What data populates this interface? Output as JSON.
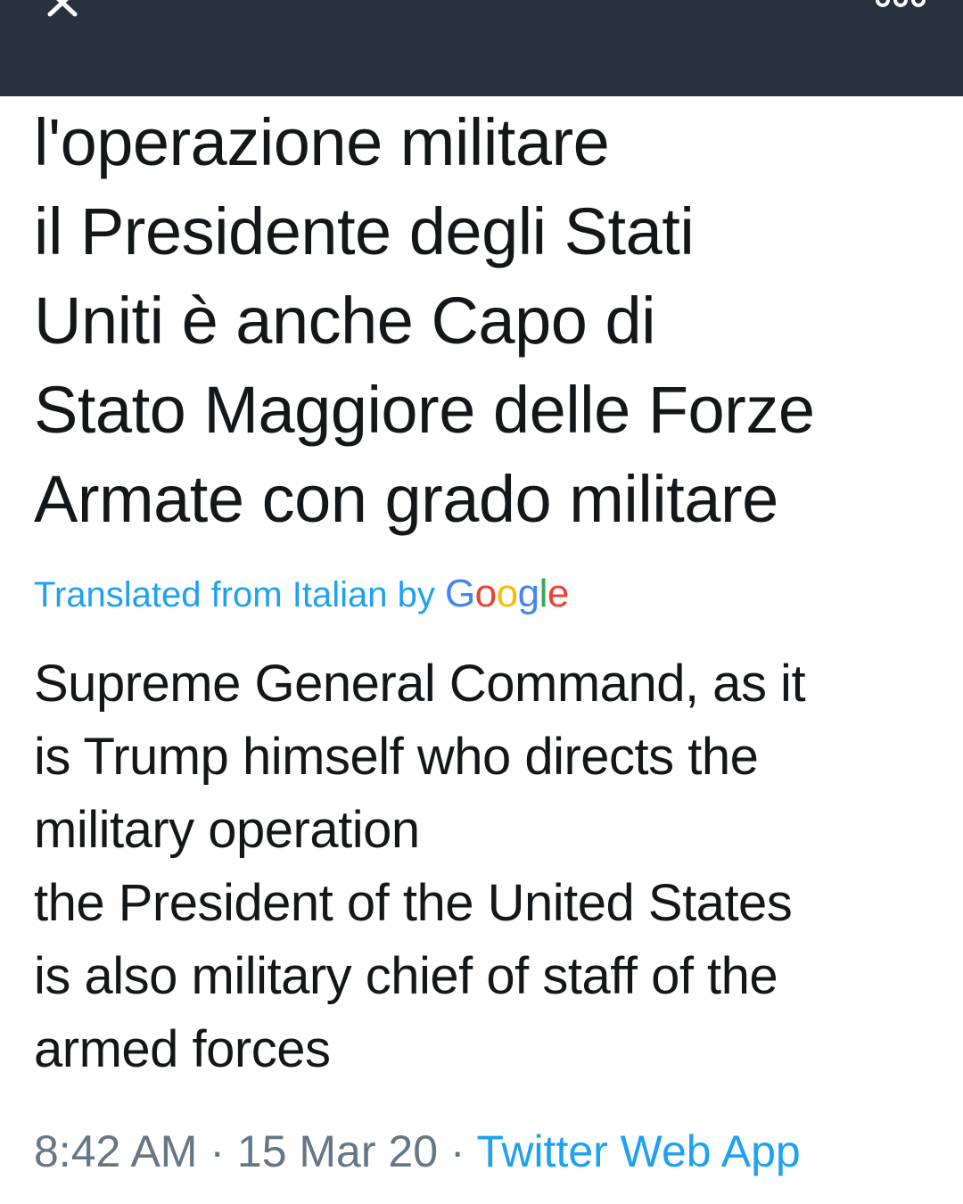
{
  "header": {
    "close_icon": "close-icon",
    "more_icon": "more-icon"
  },
  "tweet": {
    "original_text": "l'operazione militare\nil Presidente degli Stati\nUniti è anche Capo di\nStato Maggiore delle Forze\nArmate con grado militare",
    "translation_label": "Translated from Italian by ",
    "translation_provider": "Google",
    "translated_text": "Supreme General Command, as it\nis Trump himself who directs the\nmilitary operation\n the President of the United States\nis also military chief of staff of the\narmed forces",
    "time": "8:42 AM",
    "date": "15 Mar 20",
    "separator": " · ",
    "source": "Twitter Web App"
  },
  "colors": {
    "header_bg": "#28323f",
    "text": "#14171a",
    "link": "#1da1f2",
    "muted": "#657786"
  }
}
